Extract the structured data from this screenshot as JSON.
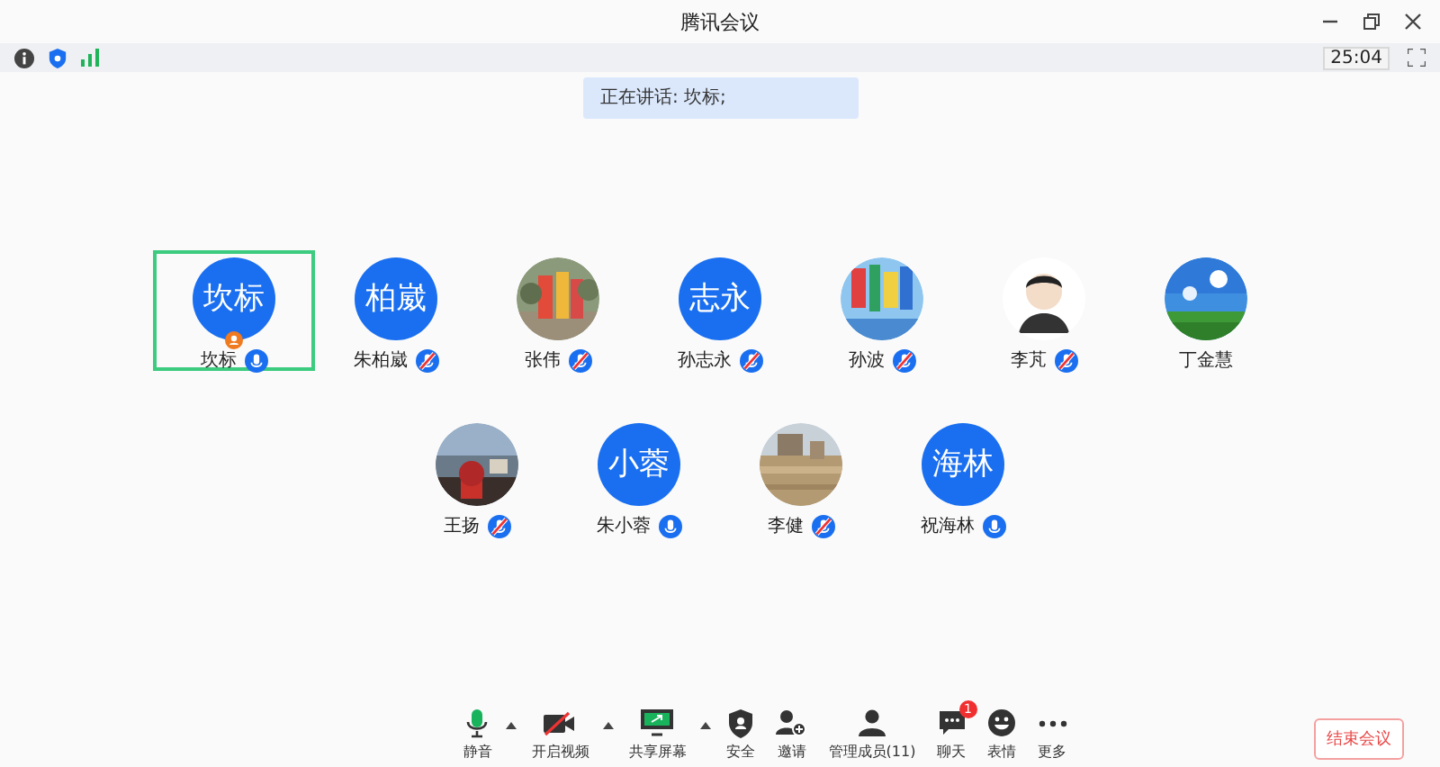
{
  "window": {
    "title": "腾讯会议"
  },
  "status_bar": {
    "timer": "25:04"
  },
  "speaking": {
    "text": "正在讲话: 坎标;"
  },
  "participants": [
    {
      "name": "坎标",
      "kind": "text",
      "avatar_text": "坎标",
      "has_mic": true,
      "muted": false,
      "selected": true,
      "host": true
    },
    {
      "name": "朱柏崴",
      "kind": "text",
      "avatar_text": "柏崴",
      "has_mic": true,
      "muted": true,
      "selected": false,
      "host": false
    },
    {
      "name": "张伟",
      "kind": "picture",
      "has_mic": true,
      "muted": true,
      "selected": false,
      "host": false
    },
    {
      "name": "孙志永",
      "kind": "text",
      "avatar_text": "志永",
      "has_mic": true,
      "muted": true,
      "selected": false,
      "host": false
    },
    {
      "name": "孙波",
      "kind": "picture",
      "has_mic": true,
      "muted": true,
      "selected": false,
      "host": false
    },
    {
      "name": "李芃",
      "kind": "figure",
      "has_mic": true,
      "muted": true,
      "selected": false,
      "host": false
    },
    {
      "name": "丁金慧",
      "kind": "picture",
      "has_mic": false,
      "selected": false,
      "host": false
    },
    {
      "name": "王扬",
      "kind": "picture",
      "has_mic": true,
      "muted": true,
      "selected": false,
      "host": false
    },
    {
      "name": "朱小蓉",
      "kind": "text",
      "avatar_text": "小蓉",
      "has_mic": true,
      "muted": false,
      "selected": false,
      "host": false
    },
    {
      "name": "李健",
      "kind": "picture",
      "has_mic": true,
      "muted": true,
      "selected": false,
      "host": false
    },
    {
      "name": "祝海林",
      "kind": "text",
      "avatar_text": "海林",
      "has_mic": true,
      "muted": false,
      "selected": false,
      "host": false
    }
  ],
  "toolbar": [
    {
      "kind": "mic",
      "label": "静音",
      "dropdown": true
    },
    {
      "kind": "video",
      "label": "开启视频",
      "dropdown": true
    },
    {
      "kind": "share",
      "label": "共享屏幕",
      "dropdown": true
    },
    {
      "kind": "security",
      "label": "安全",
      "dropdown": false
    },
    {
      "kind": "invite",
      "label": "邀请",
      "dropdown": false
    },
    {
      "kind": "members",
      "label": "管理成员(11)",
      "dropdown": false
    },
    {
      "kind": "chat",
      "label": "聊天",
      "dropdown": false,
      "badge": "1"
    },
    {
      "kind": "emoji",
      "label": "表情",
      "dropdown": false
    },
    {
      "kind": "more",
      "label": "更多",
      "dropdown": false
    }
  ],
  "end_button": {
    "label": "结束会议"
  }
}
